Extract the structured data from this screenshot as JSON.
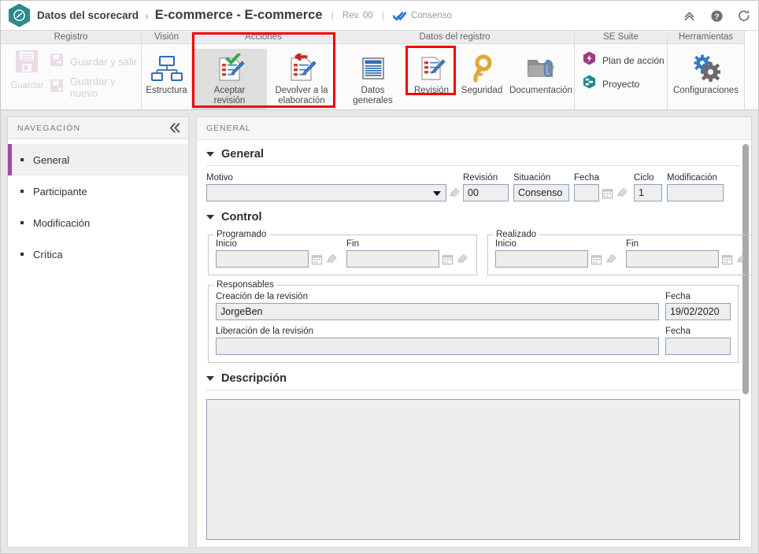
{
  "titlebar": {
    "breadcrumb_root": "Datos del scorecard",
    "breadcrumb_sep": "›",
    "title": "E-commerce - E-commerce",
    "revision_label": "Rev. 00",
    "status_label": "Consenso",
    "separator": "|",
    "icons": {
      "collapse": "chevron-double-up-icon",
      "help": "help-icon",
      "refresh": "refresh-icon"
    },
    "accent_color": "#2b8a8a",
    "status_color": "#2e74d2"
  },
  "ribbon": {
    "groups": [
      {
        "name": "registro",
        "title": "Registro",
        "save_label": "Guardar",
        "items": [
          {
            "name": "guardar-y-salir",
            "label": "Guardar y salir",
            "disabled": true
          },
          {
            "name": "guardar-y-nuevo",
            "label": "Guardar y nuevo",
            "disabled": true
          }
        ]
      },
      {
        "name": "vision",
        "title": "Visión",
        "items": [
          {
            "name": "estructura",
            "label": "Estructura",
            "icon": "structure-icon"
          }
        ]
      },
      {
        "name": "acciones",
        "title": "Acciones",
        "highlighted": true,
        "items": [
          {
            "name": "aceptar-revision",
            "label": "Aceptar revisión",
            "icon": "accept-review-icon",
            "selected": true
          },
          {
            "name": "devolver-a-la-elaboracion",
            "label": "Devolver a la\nelaboración",
            "icon": "return-review-icon"
          }
        ]
      },
      {
        "name": "datos-del-registro",
        "title": "Datos del registro",
        "items": [
          {
            "name": "datos-generales",
            "label": "Datos generales",
            "icon": "general-data-icon"
          },
          {
            "name": "revision",
            "label": "Revisión",
            "icon": "review-icon",
            "highlighted": true
          },
          {
            "name": "seguridad",
            "label": "Seguridad",
            "icon": "key-icon"
          },
          {
            "name": "documentacion",
            "label": "Documentación",
            "icon": "folder-attachment-icon"
          }
        ]
      },
      {
        "name": "se-suite",
        "title": "SE Suite",
        "items": [
          {
            "name": "plan-de-accion",
            "label": "Plan de acción",
            "icon": "action-plan-icon",
            "color": "#a03a7e"
          },
          {
            "name": "proyecto",
            "label": "Proyecto",
            "icon": "project-icon",
            "color": "#1b8a8a"
          }
        ]
      },
      {
        "name": "herramientas",
        "title": "Herramientas",
        "items": [
          {
            "name": "configuraciones",
            "label": "Configuraciones",
            "icon": "gears-icon"
          }
        ]
      }
    ],
    "highlight_color": "#f40000"
  },
  "navigation": {
    "header": "NAVEGACIÓN",
    "collapse_icon": "chevron-double-left-icon",
    "active_color": "#9a4d9e",
    "items": [
      {
        "name": "general",
        "label": "General",
        "active": true
      },
      {
        "name": "participante",
        "label": "Participante",
        "active": false
      },
      {
        "name": "modificacion",
        "label": "Modificación",
        "active": false
      },
      {
        "name": "critica",
        "label": "Crítica",
        "active": false
      }
    ]
  },
  "main": {
    "header": "GENERAL",
    "sections": {
      "general": {
        "title": "General",
        "fields": {
          "motivo": {
            "label": "Motivo",
            "value": "",
            "placeholder": ""
          },
          "revision": {
            "label": "Revisión",
            "value": "00"
          },
          "situacion": {
            "label": "Situación",
            "value": "Consenso"
          },
          "fecha": {
            "label": "Fecha",
            "value": ""
          },
          "ciclo": {
            "label": "Ciclo",
            "value": "1"
          },
          "modificacion": {
            "label": "Modificación",
            "value": ""
          }
        }
      },
      "control": {
        "title": "Control",
        "programado": {
          "legend": "Programado",
          "inicio": {
            "label": "Inicio",
            "value": ""
          },
          "fin": {
            "label": "Fin",
            "value": ""
          }
        },
        "realizado": {
          "legend": "Realizado",
          "inicio": {
            "label": "Inicio",
            "value": ""
          },
          "fin": {
            "label": "Fin",
            "value": ""
          }
        },
        "responsables": {
          "legend": "Responsables",
          "creacion": {
            "label": "Creación de la revisión",
            "value": "JorgeBen"
          },
          "creacion_fecha": {
            "label": "Fecha",
            "value": "19/02/2020"
          },
          "liberacion": {
            "label": "Liberación de la revisión",
            "value": ""
          },
          "liberacion_fecha": {
            "label": "Fecha",
            "value": ""
          }
        }
      },
      "descripcion": {
        "title": "Descripción",
        "value": ""
      }
    },
    "icons": {
      "calendar": "calendar-icon",
      "clear": "eraser-icon",
      "dropdown": "chevron-down-icon"
    }
  }
}
